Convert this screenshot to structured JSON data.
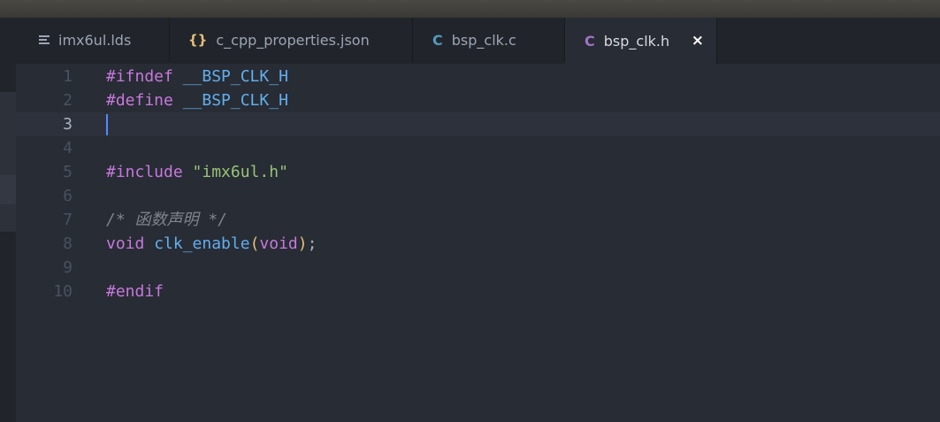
{
  "tabs": [
    {
      "label": "imx6ul.lds",
      "icon": "text-lines-icon",
      "icon_text": ""
    },
    {
      "label": "c_cpp_properties.json",
      "icon": "json-braces-icon",
      "icon_text": "{}"
    },
    {
      "label": "bsp_clk.c",
      "icon": "c-file-icon",
      "icon_text": "C"
    },
    {
      "label": "bsp_clk.h",
      "icon": "c-file-icon",
      "icon_text": "C",
      "active": true,
      "close": "×"
    }
  ],
  "colors": {
    "json_icon": "#e5c07b",
    "c_icon": "#519aba",
    "h_icon": "#a074c4"
  },
  "editor": {
    "line_numbers": [
      "1",
      "2",
      "3",
      "4",
      "5",
      "6",
      "7",
      "8",
      "9",
      "10"
    ],
    "current_line": 3,
    "lines": [
      {
        "directive": "#ifndef",
        "macro": "__BSP_CLK_H"
      },
      {
        "directive": "#define",
        "macro": "__BSP_CLK_H"
      },
      {},
      {},
      {
        "directive": "#include",
        "string": "\"imx6ul.h\""
      },
      {},
      {
        "comment": "/* 函数声明 */"
      },
      {
        "ret_type": "void",
        "func": "clk_enable",
        "lparen": "(",
        "param": "void",
        "rparen": ")",
        "semi": ";"
      },
      {},
      {
        "directive": "#endif"
      }
    ]
  }
}
